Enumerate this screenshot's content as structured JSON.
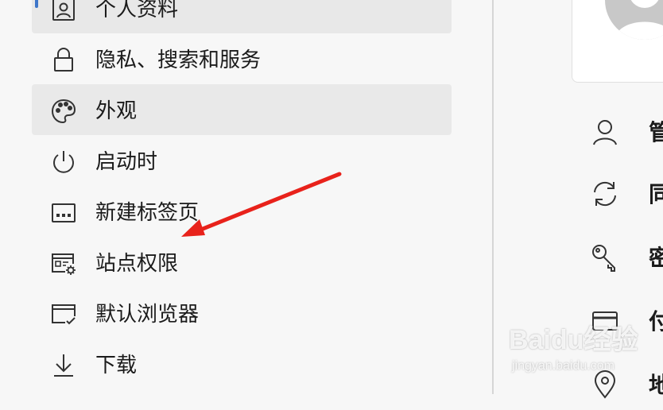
{
  "nav": {
    "items": [
      {
        "label": "个人资料",
        "icon": "profile-icon",
        "state": "selected"
      },
      {
        "label": "隐私、搜索和服务",
        "icon": "lock-icon",
        "state": "normal"
      },
      {
        "label": "外观",
        "icon": "palette-icon",
        "state": "hovered"
      },
      {
        "label": "启动时",
        "icon": "power-icon",
        "state": "normal"
      },
      {
        "label": "新建标签页",
        "icon": "new-tab-page-icon",
        "state": "normal"
      },
      {
        "label": "站点权限",
        "icon": "site-permissions-icon",
        "state": "normal"
      },
      {
        "label": "默认浏览器",
        "icon": "default-browser-icon",
        "state": "normal"
      },
      {
        "label": "下载",
        "icon": "download-icon",
        "state": "normal"
      }
    ]
  },
  "profile_panel": {
    "items": [
      {
        "label": "管",
        "icon": "person-icon"
      },
      {
        "label": "同",
        "icon": "sync-icon"
      },
      {
        "label": "密",
        "icon": "key-icon"
      },
      {
        "label": "付",
        "icon": "card-icon"
      },
      {
        "label": "地",
        "icon": "location-icon"
      }
    ]
  },
  "annotation": {
    "type": "arrow",
    "color": "#e8221b",
    "points_to": "站点权限"
  },
  "watermark": {
    "brand": "Baidu经验",
    "sub": "jingyan.baidu.com"
  },
  "colors": {
    "accent": "#3e76c9",
    "selected_bg": "#e8e8e8",
    "page_bg": "#f7f7f7"
  }
}
